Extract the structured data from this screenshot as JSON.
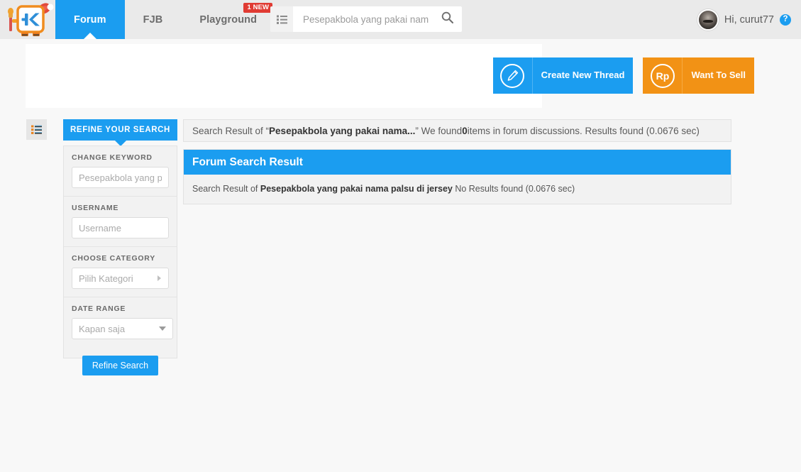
{
  "header": {
    "logo_icon": "kaskus-mascot-logo",
    "tabs": [
      {
        "label": "Forum",
        "active": true,
        "badge": null
      },
      {
        "label": "FJB",
        "active": false,
        "badge": null
      },
      {
        "label": "Playground",
        "active": false,
        "badge": "1 NEW"
      }
    ],
    "search": {
      "list_icon": "list-icon",
      "value": "Pesepakbola yang pakai nam",
      "placeholder": "Pesepakbola yang pakai nam",
      "go_icon": "search-icon"
    },
    "user": {
      "greeting": "Hi, curut77",
      "avatar_icon": "user-avatar",
      "help_label": "?"
    }
  },
  "actions": [
    {
      "label": "Create New Thread",
      "icon": "pencil-icon",
      "icon_glyph": "✎",
      "color": "#1b9df0"
    },
    {
      "label": "Want To Sell",
      "icon": "rupiah-icon",
      "icon_glyph": "Rp",
      "color": "#f29215"
    }
  ],
  "sidebar": {
    "toggle_icon": "list-toggle-icon",
    "header": "REFINE YOUR SEARCH",
    "fields": [
      {
        "label": "CHANGE KEYWORD",
        "type": "input",
        "value": "",
        "placeholder": "Pesepakbola yang pa"
      },
      {
        "label": "USERNAME",
        "type": "input",
        "value": "",
        "placeholder": "Username"
      },
      {
        "label": "CHOOSE CATEGORY",
        "type": "select-right",
        "value": "Pilih Kategori"
      },
      {
        "label": "DATE RANGE",
        "type": "select-down",
        "value": "Kapan saja"
      }
    ],
    "submit_label": "Refine Search"
  },
  "main": {
    "result_bar": {
      "prefix": "Search Result of “",
      "query": "Pesepakbola yang pakai nama...",
      "middle": "” We found ",
      "count": "0",
      "suffix": " items in forum discussions. Results found (0.0676 sec)"
    },
    "panel": {
      "title": "Forum Search Result",
      "body_prefix": "Search Result of ",
      "body_query": "Pesepakbola yang pakai nama palsu di jersey",
      "body_suffix": " No Results found (0.0676 sec)"
    }
  },
  "colors": {
    "accent": "#1b9df0",
    "orange": "#f29215",
    "badge_red": "#e03b33",
    "header_bg": "#eaeaea",
    "page_bg": "#f8f8f8"
  }
}
